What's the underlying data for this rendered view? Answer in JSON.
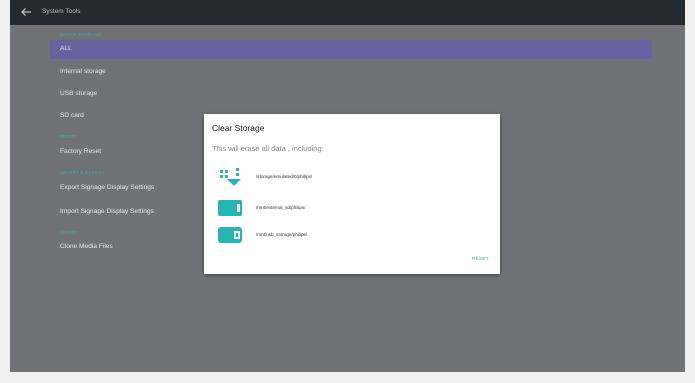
{
  "app": {
    "title": "System Tools"
  },
  "sections": {
    "clear_storage": "CLEAR STORAGE",
    "reset": "RESET",
    "import_export": "IMPORT & EXPORT",
    "clone": "Clone"
  },
  "items": {
    "all": "ALL",
    "internal": "Internal storage",
    "usb": "USB storage",
    "sd": "SD card",
    "factory_reset": "Factory Reset",
    "export": "Export Signage Display Settings",
    "import": "Import Signage Display Settings",
    "clone_media": "Clone Media Files"
  },
  "dialog": {
    "title": "Clear Storage",
    "message": "This will erase all data , including:",
    "paths": [
      {
        "icon": "internal-storage-icon",
        "path": "/storage/emulated/0/philips/"
      },
      {
        "icon": "sd-card-icon",
        "path": "/mnt/external_sd/philips/"
      },
      {
        "icon": "usb-icon",
        "path": "/mnt/usb_storage/philips/"
      }
    ],
    "reset_label": "RESET"
  },
  "colors": {
    "accent": "#2ab3b3",
    "selected_row": "#6663a0",
    "background": "#717275",
    "topbar": "#232b30"
  }
}
